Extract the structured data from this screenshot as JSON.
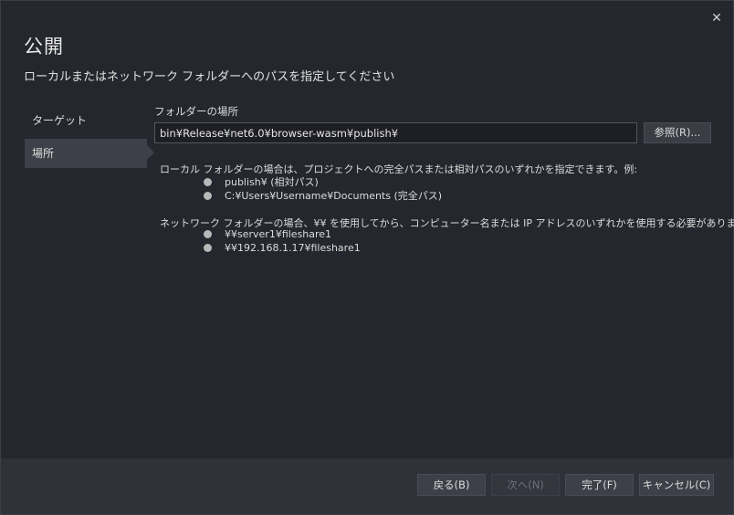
{
  "dialog": {
    "title": "公開",
    "subtitle": "ローカルまたはネットワーク フォルダーへのパスを指定してください",
    "close_glyph": "✕"
  },
  "nav": {
    "items": [
      {
        "label": "ターゲット",
        "selected": false
      },
      {
        "label": "場所",
        "selected": true
      }
    ]
  },
  "location": {
    "label": "フォルダーの場所",
    "value": "bin¥Release¥net6.0¥browser-wasm¥publish¥",
    "browse_label": "参照(R)..."
  },
  "help": {
    "local_intro": "ローカル フォルダーの場合は、プロジェクトへの完全パスまたは相対パスのいずれかを指定できます。例:",
    "local_examples": [
      "publish¥ (相対パス)",
      "C:¥Users¥Username¥Documents (完全パス)"
    ],
    "network_intro": "ネットワーク フォルダーの場合、¥¥ を使用してから、コンピューター名または IP アドレスのいずれかを使用する必要があります。例:",
    "network_examples": [
      "¥¥server1¥fileshare1",
      "¥¥192.168.1.17¥fileshare1"
    ]
  },
  "footer": {
    "back_label": "戻る(B)",
    "next_label": "次へ(N)",
    "finish_label": "完了(F)",
    "cancel_label": "キャンセル(C)"
  },
  "colors": {
    "background": "#25272e",
    "footer": "#30323a",
    "selected_nav": "#3e4049"
  }
}
